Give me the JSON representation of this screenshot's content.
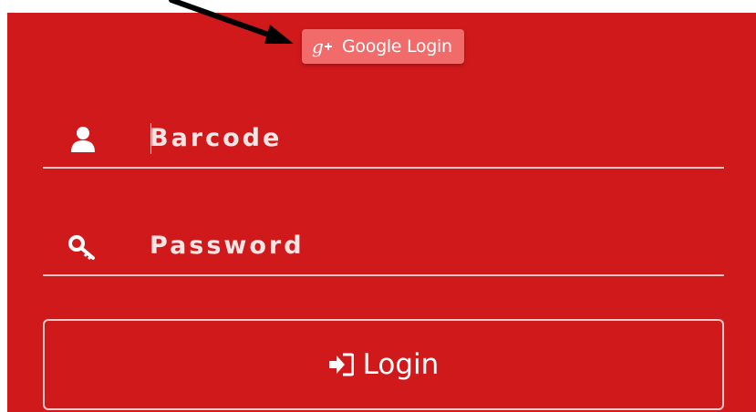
{
  "google_button": {
    "label": "Google Login",
    "icon": "google-plus-icon",
    "color": "#f26b6b"
  },
  "barcode_field": {
    "placeholder": "Barcode",
    "value": "",
    "icon": "user-icon"
  },
  "password_field": {
    "placeholder": "Password",
    "value": "",
    "icon": "key-icon"
  },
  "login_button": {
    "label": "Login",
    "icon": "sign-in-icon"
  },
  "colors": {
    "panel_background": "#d0191b",
    "foreground": "#ffffff",
    "underline": "#f1c9c9"
  }
}
